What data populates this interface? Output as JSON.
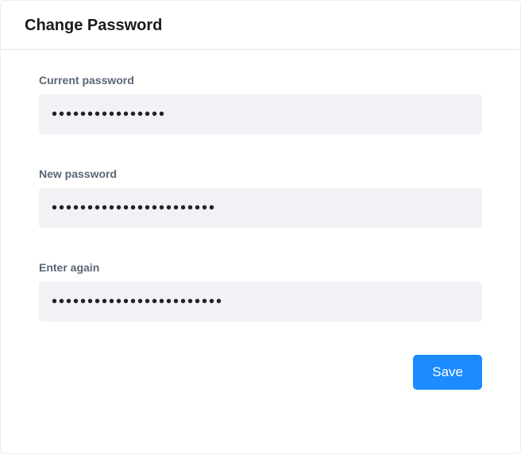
{
  "header": {
    "title": "Change Password"
  },
  "form": {
    "current_password": {
      "label": "Current password",
      "value": "aaaaaaaaaaaaaaaa"
    },
    "new_password": {
      "label": "New password",
      "value": "aaaaaaaaaaaaaaaaaaaaaaa"
    },
    "confirm_password": {
      "label": "Enter again",
      "value": "aaaaaaaaaaaaaaaaaaaaaaaa"
    }
  },
  "actions": {
    "save_label": "Save"
  }
}
